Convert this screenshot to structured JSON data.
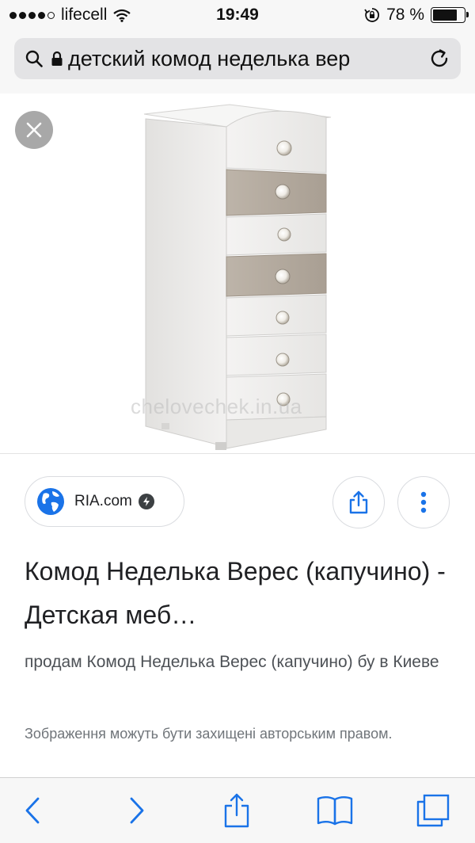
{
  "status_bar": {
    "carrier": "lifecell",
    "time": "19:49",
    "battery_text": "78 %",
    "battery_level": 0.78
  },
  "url_bar": {
    "text": "детский комод неделька вер"
  },
  "image": {
    "watermark": "chelovechek.in.ua"
  },
  "result": {
    "source_name": "RIA.com",
    "title": "Комод Неделька Верес (капучино) - Детская меб…",
    "description": "продам Комод Неделька Верес (капучино) бу в Киеве",
    "copyright_note": "Зображення можуть бути захищені авторським правом."
  },
  "colors": {
    "accent": "#1a73e8",
    "cappuccino_drawer": "#b8afa4",
    "dresser_white": "#ecebea"
  },
  "icons": {
    "close": "close-icon",
    "search": "search-icon",
    "lock": "lock-icon",
    "reload": "reload-icon",
    "share": "share-icon",
    "more": "more-vert-icon",
    "back": "chevron-left-icon",
    "forward": "chevron-right-icon",
    "bookmarks": "book-icon",
    "tabs": "tabs-icon"
  }
}
